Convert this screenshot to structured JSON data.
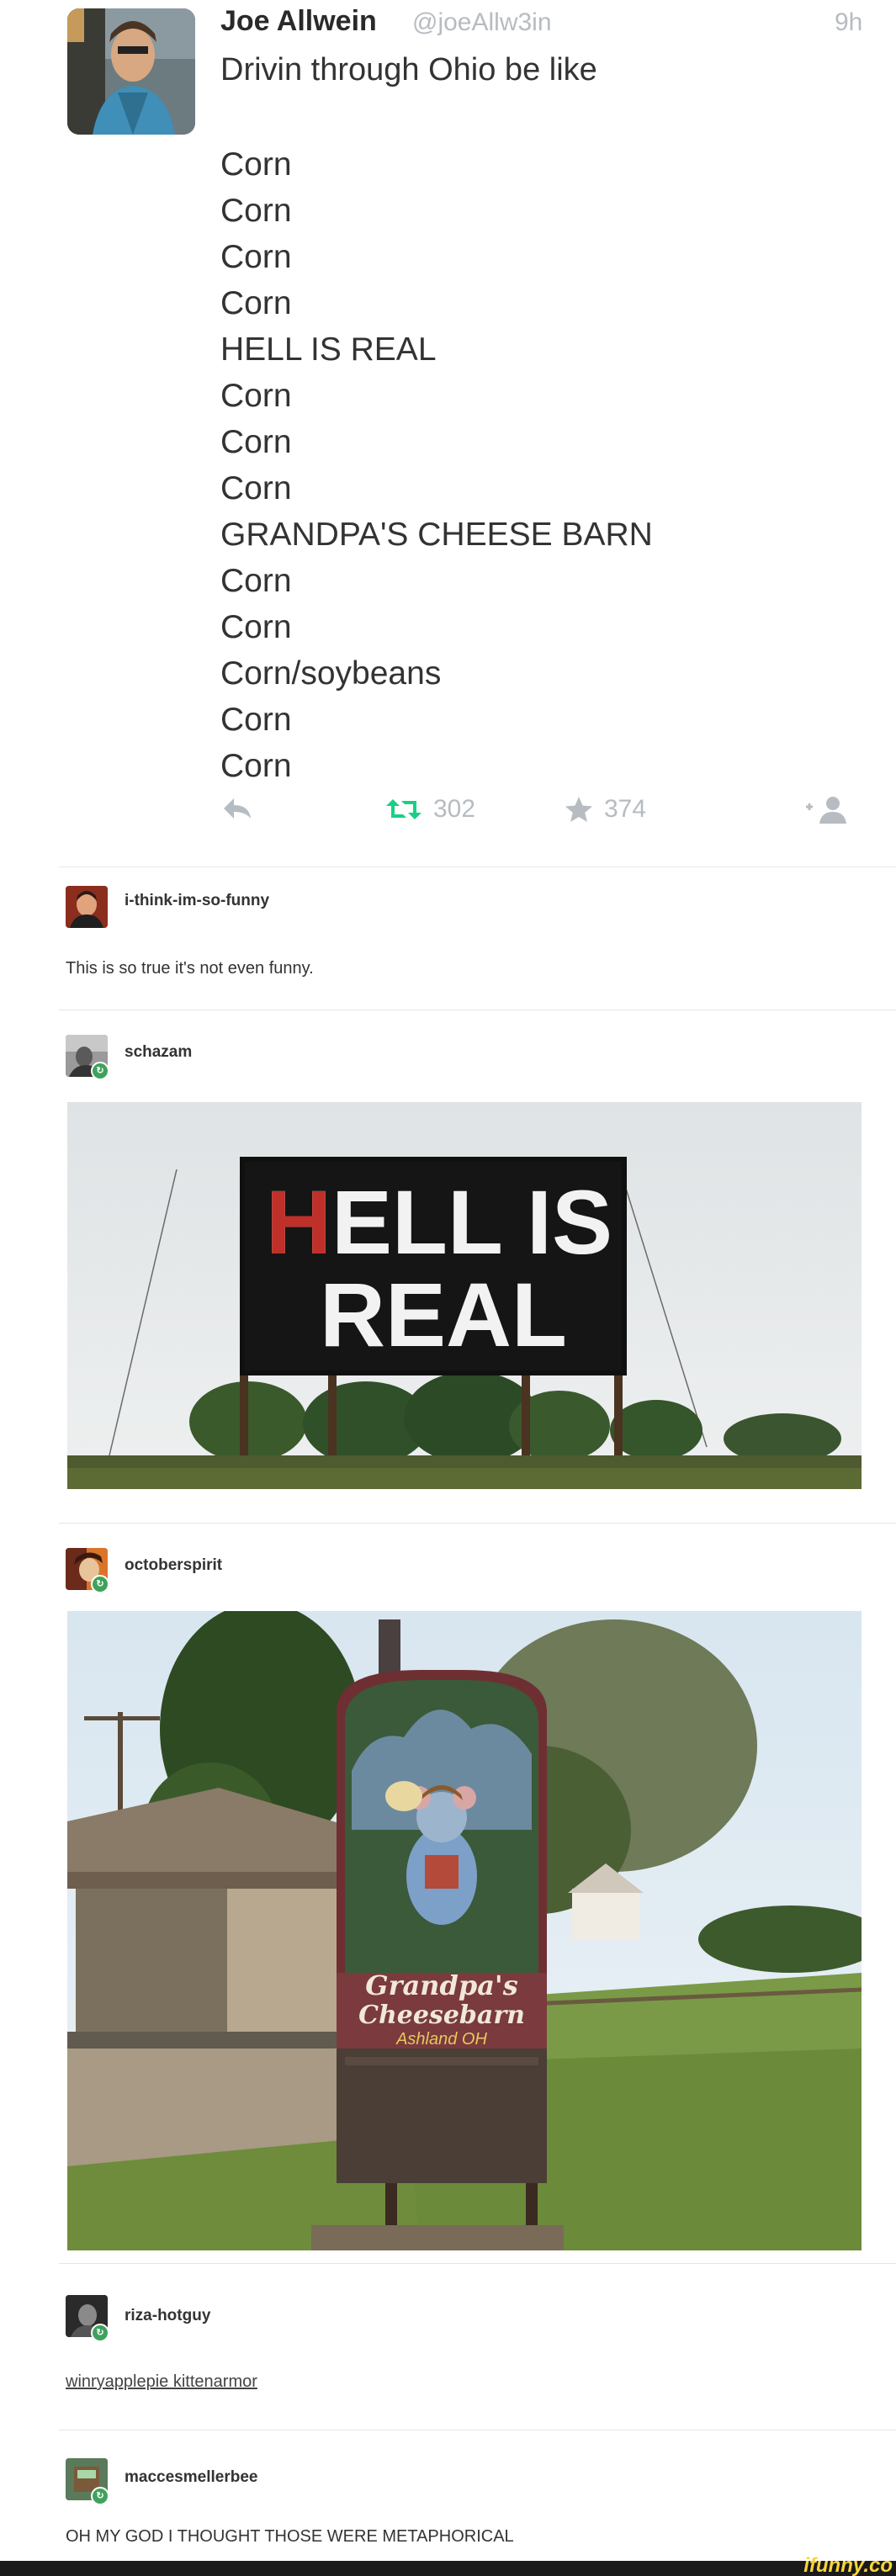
{
  "tweet": {
    "name": "Joe Allwein",
    "handle": "@joeAllw3in",
    "time": "9h",
    "text": "Drivin through Ohio be like",
    "lines": [
      "Corn",
      "Corn",
      "Corn",
      "Corn",
      "HELL IS REAL",
      "Corn",
      "Corn",
      "Corn",
      "GRANDPA'S CHEESE BARN",
      "Corn",
      "Corn",
      "Corn/soybeans",
      "Corn",
      "Corn"
    ],
    "retweets": "302",
    "favorites": "374",
    "icons": {
      "reply": "reply-icon",
      "retweet": "retweet-icon",
      "favorite": "star-icon",
      "follow": "follow-icon"
    },
    "retweet_color": "#19cf86"
  },
  "posts": [
    {
      "user": "i-think-im-so-funny",
      "text": "This is so true it's not even funny."
    },
    {
      "user": "schazam"
    },
    {
      "user": "octoberspirit"
    },
    {
      "user": "riza-hotguy",
      "text": "winryapplepie kittenarmor"
    },
    {
      "user": "maccesmellerbee",
      "text": "OH MY GOD I THOUGHT THOSE WERE METAPHORICAL"
    }
  ],
  "photo1": {
    "sign_line1": "HELL IS",
    "sign_line2": "REAL"
  },
  "photo2": {
    "sign_line1": "Grandpa's",
    "sign_line2": "Cheesebarn",
    "sign_line3": "Ashland OH"
  },
  "watermark": "ifunny.co"
}
